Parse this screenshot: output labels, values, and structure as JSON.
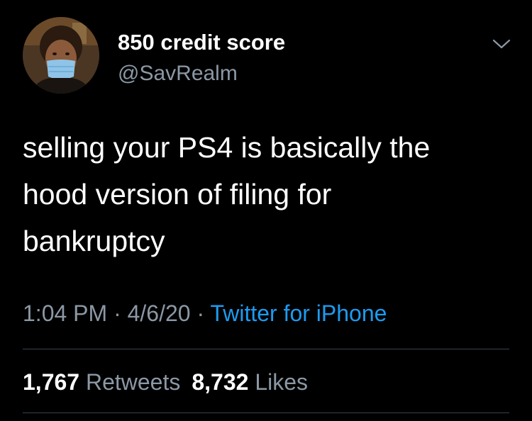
{
  "user": {
    "display_name": "850 credit score",
    "handle": "@SavRealm"
  },
  "tweet": {
    "line1": "selling your PS4 is basically the",
    "line2": "hood version of filing for",
    "line3": "bankruptcy"
  },
  "meta": {
    "time": "1:04 PM",
    "separator": " · ",
    "date": "4/6/20",
    "source": "Twitter for iPhone"
  },
  "stats": {
    "retweets_count": "1,767",
    "retweets_label": "Retweets",
    "likes_count": "8,732",
    "likes_label": "Likes"
  },
  "icons": {
    "menu": "chevron-down-icon"
  },
  "colors": {
    "background": "#000000",
    "primary_text": "#ffffff",
    "secondary_text": "#8b98a5",
    "link": "#1d9bf0",
    "divider": "#38444d"
  }
}
